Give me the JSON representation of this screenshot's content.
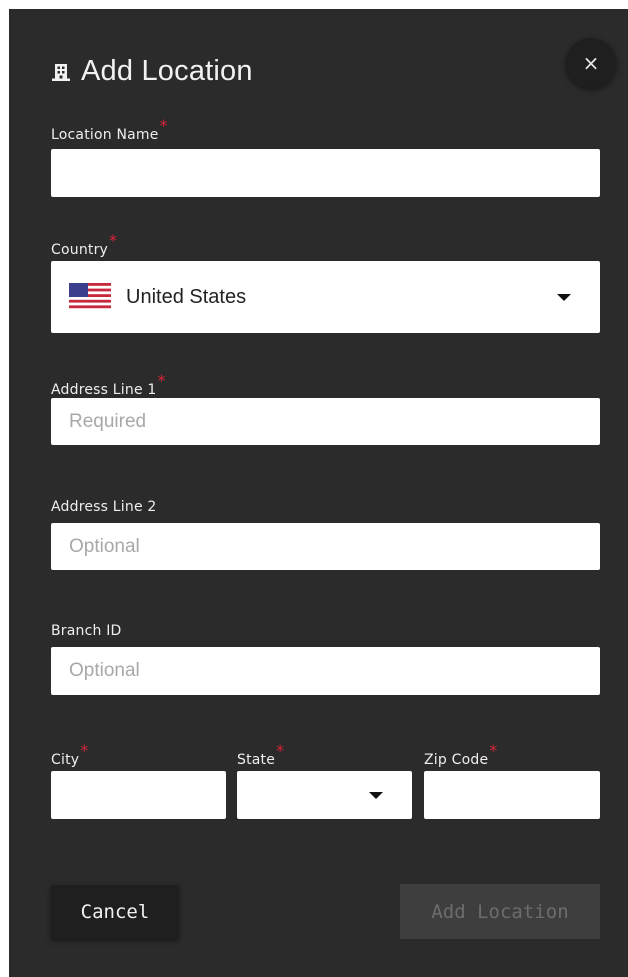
{
  "dialog": {
    "title": "Add Location",
    "close_label": "×"
  },
  "fields": {
    "location_name": {
      "label": "Location Name",
      "required_mark": "*",
      "value": "",
      "placeholder": ""
    },
    "country": {
      "label": "Country",
      "required_mark": "*",
      "value": "United States",
      "flag_icon": "us-flag-icon"
    },
    "address_line_1": {
      "label": "Address Line 1",
      "required_mark": "*",
      "value": "",
      "placeholder": "Required"
    },
    "address_line_2": {
      "label": "Address Line 2",
      "value": "",
      "placeholder": "Optional"
    },
    "branch_id": {
      "label": "Branch ID",
      "value": "",
      "placeholder": "Optional"
    },
    "city": {
      "label": "City",
      "required_mark": "*",
      "value": "",
      "placeholder": ""
    },
    "state": {
      "label": "State",
      "required_mark": "*",
      "value": ""
    },
    "zip_code": {
      "label": "Zip Code",
      "required_mark": "*",
      "value": "",
      "placeholder": ""
    }
  },
  "actions": {
    "cancel_label": "Cancel",
    "submit_label": "Add Location"
  },
  "colors": {
    "dialog_background": "#2b2b2b",
    "required_mark": "#d9243a",
    "disabled_button_bg": "#3e3e3e",
    "disabled_button_text": "#6c6c6c"
  }
}
